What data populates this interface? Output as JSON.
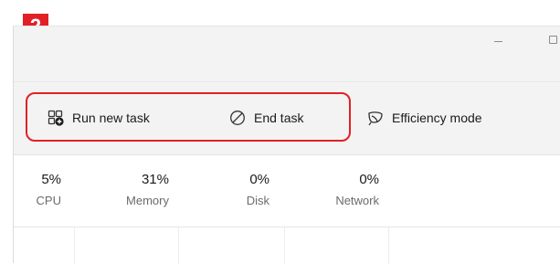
{
  "badge": {
    "number": "2",
    "color": "#e31f26"
  },
  "window_controls": {
    "minimize_icon": "minimize-icon",
    "maximize_icon": "maximize-icon"
  },
  "toolbar": {
    "run_new_task": {
      "label": "Run new task",
      "icon": "run-new-task-icon"
    },
    "end_task": {
      "label": "End task",
      "icon": "end-task-icon"
    },
    "efficiency_mode": {
      "label": "Efficiency mode",
      "icon": "efficiency-mode-icon"
    },
    "highlight_color": "#e31f26"
  },
  "stats": {
    "cpu": {
      "value": "5%",
      "label": "CPU"
    },
    "memory": {
      "value": "31%",
      "label": "Memory"
    },
    "disk": {
      "value": "0%",
      "label": "Disk"
    },
    "network": {
      "value": "0%",
      "label": "Network"
    }
  }
}
